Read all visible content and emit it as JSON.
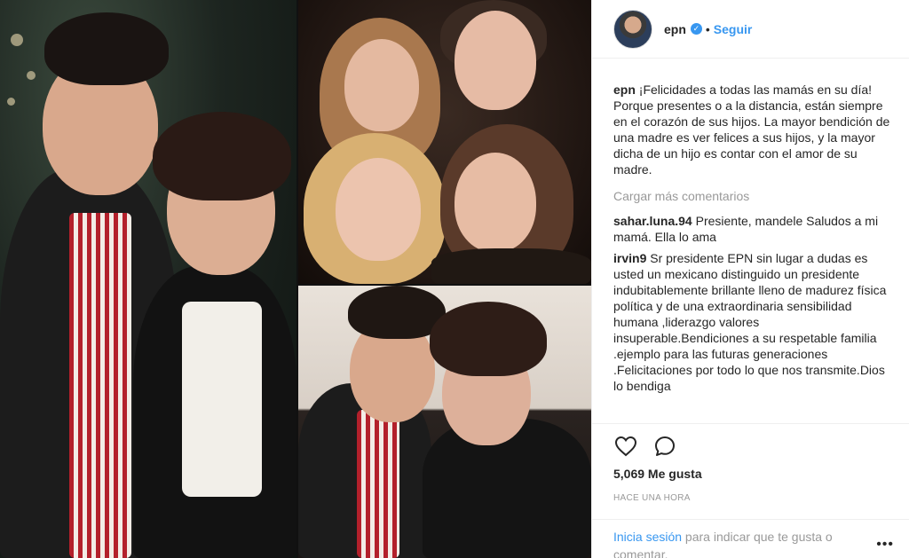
{
  "header": {
    "username": "epn",
    "verified_icon": "check-icon",
    "separator": "•",
    "follow_label": "Seguir"
  },
  "caption": {
    "username": "epn",
    "text": "¡Felicidades a todas las mamás en su día! Porque presentes o a la distancia, están siempre en el corazón de sus hijos. La mayor bendición de una madre es ver felices a sus hijos, y la mayor dicha de un hijo es contar con el amor de su madre."
  },
  "load_more_label": "Cargar más comentarios",
  "comments": [
    {
      "username": "sahar.luna.94",
      "text": "Presiente, mandele Saludos a mi mamá. Ella lo ama"
    },
    {
      "username": "irvin9",
      "text": "Sr presidente EPN sin lugar a dudas es usted un mexicano distinguido un presidente indubitablemente brillante lleno de madurez física política y de una extraordinaria sensibilidad humana ,liderazgo valores insuperable.Bendiciones a su respetable familia .ejemplo para las futuras generaciones .Felicitaciones por todo lo que nos transmite.Dios lo bendiga"
    }
  ],
  "actions": {
    "like_icon": "heart-icon",
    "comment_icon": "comment-icon",
    "likes_text": "5,069 Me gusta",
    "timestamp": "HACE UNA HORA"
  },
  "login": {
    "link_text": "Inicia sesión",
    "rest_text": " para indicar que te gusta o comentar.",
    "more_icon": "more-options-icon",
    "more_glyph": "•••"
  },
  "colors": {
    "accent": "#3897f0",
    "text": "#262626",
    "muted": "#999999",
    "border": "#efefef"
  }
}
